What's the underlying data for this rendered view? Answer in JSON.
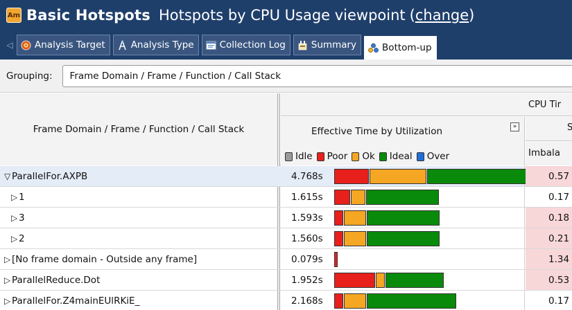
{
  "header": {
    "app_icon_text": "Am",
    "title": "Basic Hotspots",
    "subtitle": "Hotspots by CPU Usage viewpoint",
    "change_open": "(",
    "change_link": "change",
    "change_close": ")"
  },
  "tabs": [
    {
      "label": "Analysis Target",
      "icon": "target-icon",
      "active": false
    },
    {
      "label": "Analysis Type",
      "icon": "compass-icon",
      "active": false
    },
    {
      "label": "Collection Log",
      "icon": "log-icon",
      "active": false
    },
    {
      "label": "Summary",
      "icon": "summary-icon",
      "active": false
    },
    {
      "label": "Bottom-up",
      "icon": "bottom-up-icon",
      "active": true
    }
  ],
  "grouping": {
    "label": "Grouping:",
    "value": "Frame Domain / Frame / Function / Call Stack"
  },
  "table": {
    "name_header": "Frame Domain / Frame / Function / Call Stack",
    "cpu_header": "CPU Tir",
    "eff_header": "Effective Time by Utilization",
    "eff_expand": "»",
    "s_header": "S",
    "imbalance_header": "Imbala",
    "legend": [
      {
        "label": "Idle",
        "color": "#9a9a9a"
      },
      {
        "label": "Poor",
        "color": "#e8201c"
      },
      {
        "label": "Ok",
        "color": "#f5a623"
      },
      {
        "label": "Ideal",
        "color": "#0a8a0a"
      },
      {
        "label": "Over",
        "color": "#1e6fd8"
      }
    ],
    "rows": [
      {
        "name": "ParallelFor.AXPB",
        "expanded": true,
        "indent": 0,
        "time": "4.768s",
        "imbalance": "0.57",
        "imb_color": "#f8d7d9",
        "util": {
          "poor": 0.43,
          "ok": 0.7,
          "ideal": 1.55
        }
      },
      {
        "name": "1",
        "expanded": false,
        "indent": 1,
        "time": "1.615s",
        "imbalance": "0.17",
        "imb_color": "#ffffff",
        "util": {
          "poor": 0.2,
          "ok": 0.18,
          "ideal": 0.9
        }
      },
      {
        "name": "3",
        "expanded": false,
        "indent": 1,
        "time": "1.593s",
        "imbalance": "0.18",
        "imb_color": "#f8d7d9",
        "util": {
          "poor": 0.11,
          "ok": 0.27,
          "ideal": 0.9
        }
      },
      {
        "name": "2",
        "expanded": false,
        "indent": 1,
        "time": "1.560s",
        "imbalance": "0.21",
        "imb_color": "#f8d7d9",
        "util": {
          "poor": 0.11,
          "ok": 0.27,
          "ideal": 0.9
        }
      },
      {
        "name": "[No frame domain - Outside any frame]",
        "expanded": false,
        "indent": 0,
        "time": "0.079s",
        "imbalance": "1.34",
        "imb_color": "#f8d7d9",
        "util": {
          "poor": 0.04,
          "ok": 0.0,
          "ideal": 0.0
        }
      },
      {
        "name": "ParallelReduce.Dot",
        "expanded": false,
        "indent": 0,
        "time": "1.952s",
        "imbalance": "0.53",
        "imb_color": "#f8d7d9",
        "util": {
          "poor": 0.5,
          "ok": 0.11,
          "ideal": 0.72
        }
      },
      {
        "name": "ParallelFor.Z4mainEUlRKiE_",
        "expanded": false,
        "indent": 0,
        "time": "2.168s",
        "imbalance": "0.17",
        "imb_color": "#ffffff",
        "util": {
          "poor": 0.11,
          "ok": 0.27,
          "ideal": 1.1
        }
      }
    ]
  }
}
